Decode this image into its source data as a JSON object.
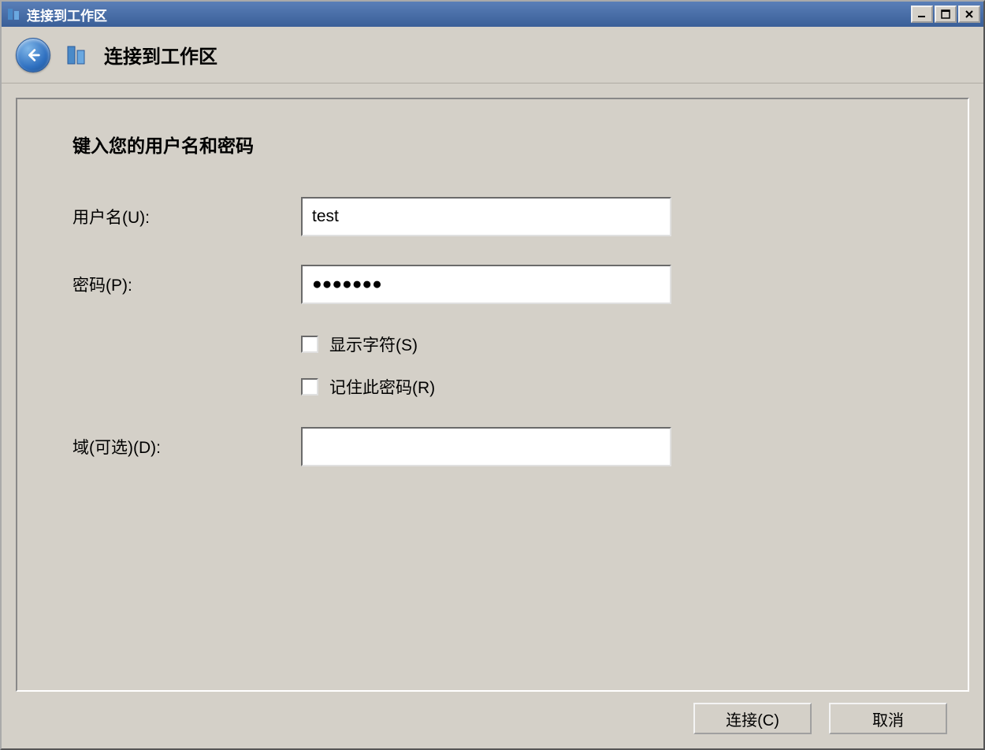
{
  "window": {
    "title": "连接到工作区"
  },
  "header": {
    "title": "连接到工作区"
  },
  "form": {
    "instruction": "键入您的用户名和密码",
    "username_label": "用户名(U):",
    "username_value": "test",
    "password_label": "密码(P):",
    "password_value": "●●●●●●●",
    "show_chars_label": "显示字符(S)",
    "remember_label": "记住此密码(R)",
    "domain_label": "域(可选)(D):",
    "domain_value": ""
  },
  "buttons": {
    "connect": "连接(C)",
    "cancel": "取消"
  }
}
